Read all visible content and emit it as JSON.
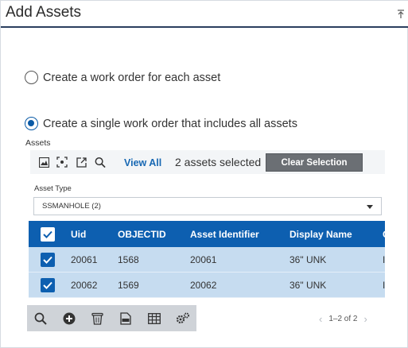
{
  "header": {
    "title": "Add Assets",
    "collapse_icon": "collapse-up-icon"
  },
  "options": [
    {
      "label": "Create a work order for each asset",
      "selected": false
    },
    {
      "label": "Create a single work order that includes all assets",
      "selected": true
    }
  ],
  "assets": {
    "label": "Assets",
    "toolbar": {
      "icons": [
        "map-icon",
        "zoom-to-selection-icon",
        "open-external-icon",
        "search-icon"
      ],
      "view_all": "View All",
      "selected_text": "2 assets selected",
      "clear_selection": "Clear Selection"
    },
    "asset_type": {
      "label": "Asset Type",
      "value": "SSMANHOLE (2)"
    },
    "table": {
      "columns": [
        "Uid",
        "OBJECTID",
        "Asset Identifier",
        "Display Name",
        "C"
      ],
      "rows": [
        {
          "checked": true,
          "cells": [
            "20061",
            "1568",
            "20061",
            "36\" UNK",
            "I"
          ]
        },
        {
          "checked": true,
          "cells": [
            "20062",
            "1569",
            "20062",
            "36\" UNK",
            "I"
          ]
        }
      ]
    },
    "bottom_toolbar": {
      "icons": [
        "search-icon",
        "add-icon",
        "delete-icon",
        "export-csv-icon",
        "table-view-icon",
        "settings-icon"
      ]
    },
    "pager": {
      "text": "1–2 of 2"
    }
  },
  "colors": {
    "accent": "#0d5fb0",
    "row_selected": "#c6dcf0",
    "header_rule": "#2a3f5f"
  }
}
